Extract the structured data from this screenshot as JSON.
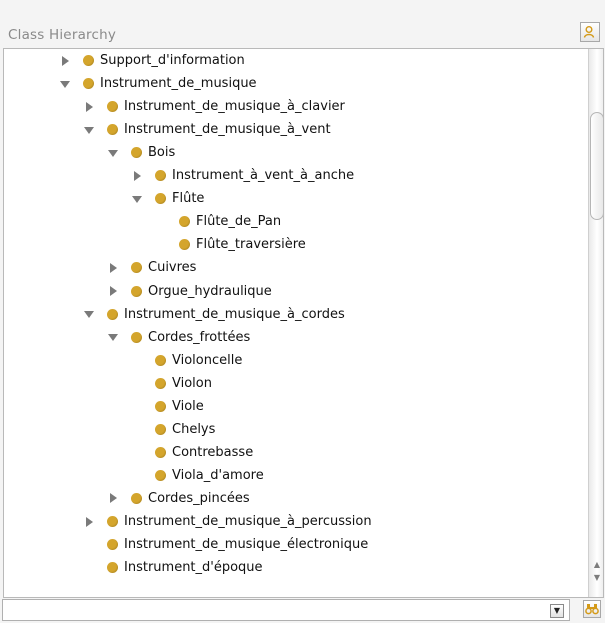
{
  "header": {
    "title": "Class Hierarchy",
    "search_icon": "person-search-icon"
  },
  "tree": {
    "items": [
      {
        "label": "Support_d'information",
        "expander": "collapsed"
      },
      {
        "label": "Instrument_de_musique",
        "expander": "expanded"
      },
      {
        "label": "Instrument_de_musique_à_clavier",
        "expander": "collapsed"
      },
      {
        "label": "Instrument_de_musique_à_vent",
        "expander": "expanded"
      },
      {
        "label": "Bois",
        "expander": "expanded"
      },
      {
        "label": "Instrument_à_vent_à_anche",
        "expander": "collapsed"
      },
      {
        "label": "Flûte",
        "expander": "expanded"
      },
      {
        "label": "Flûte_de_Pan",
        "expander": "none"
      },
      {
        "label": "Flûte_traversière",
        "expander": "none"
      },
      {
        "label": "Cuivres",
        "expander": "collapsed"
      },
      {
        "label": "Orgue_hydraulique",
        "expander": "collapsed"
      },
      {
        "label": "Instrument_de_musique_à_cordes",
        "expander": "expanded"
      },
      {
        "label": "Cordes_frottées",
        "expander": "expanded"
      },
      {
        "label": "Violoncelle",
        "expander": "none"
      },
      {
        "label": "Violon",
        "expander": "none"
      },
      {
        "label": "Viole",
        "expander": "none"
      },
      {
        "label": "Chelys",
        "expander": "none"
      },
      {
        "label": "Contrebasse",
        "expander": "none"
      },
      {
        "label": "Viola_d'amore",
        "expander": "none"
      },
      {
        "label": "Cordes_pincées",
        "expander": "collapsed"
      },
      {
        "label": "Instrument_de_musique_à_percussion",
        "expander": "collapsed"
      },
      {
        "label": "Instrument_de_musique_électronique",
        "expander": "none"
      },
      {
        "label": "Instrument_d'époque",
        "expander": "none"
      }
    ]
  },
  "footer": {
    "search_value": "",
    "find_icon": "binoculars-icon"
  },
  "colors": {
    "class_dot": "#d4a52c",
    "expander": "#7a7a7a"
  }
}
